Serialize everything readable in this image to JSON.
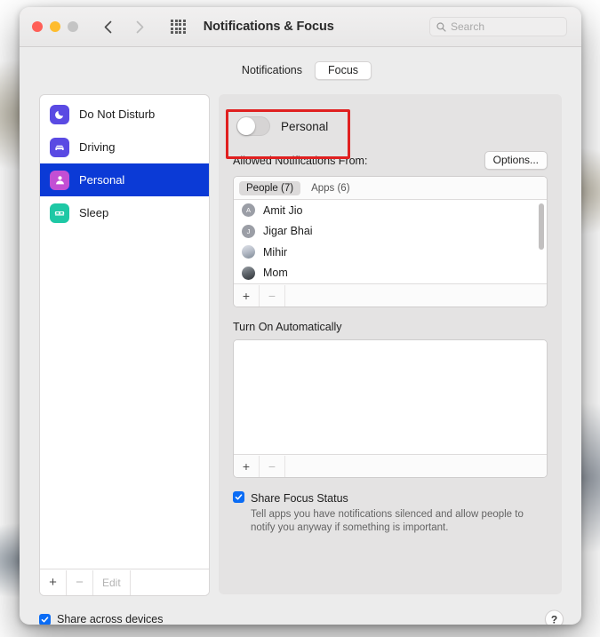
{
  "window": {
    "title": "Notifications & Focus",
    "traffic_lights": [
      "close",
      "minimize",
      "zoom"
    ],
    "back_label": "‹",
    "forward_label": "›"
  },
  "search": {
    "placeholder": "Search",
    "value": ""
  },
  "segmented": {
    "tabs": [
      {
        "label": "Notifications",
        "active": false
      },
      {
        "label": "Focus",
        "active": true
      }
    ]
  },
  "sidebar": {
    "items": [
      {
        "label": "Do Not Disturb",
        "icon": "moon-icon",
        "color": "#5a4ae3",
        "selected": false
      },
      {
        "label": "Driving",
        "icon": "car-icon",
        "color": "#5a4ae3",
        "selected": false
      },
      {
        "label": "Personal",
        "icon": "person-icon",
        "color": "#c34fd4",
        "selected": true
      },
      {
        "label": "Sleep",
        "icon": "bed-icon",
        "color": "#1ec8a5",
        "selected": false
      }
    ],
    "footer": {
      "add_label": "+",
      "remove_label": "−",
      "edit_label": "Edit"
    }
  },
  "detail": {
    "toggle": {
      "name": "Personal",
      "on": false
    },
    "allowed": {
      "title": "Allowed Notifications From:",
      "options_button": "Options...",
      "tabs": [
        {
          "label": "People (7)",
          "active": true
        },
        {
          "label": "Apps (6)",
          "active": false
        }
      ],
      "people": [
        {
          "name": "Amit Jio",
          "initial": "A",
          "avatar": "initial"
        },
        {
          "name": "Jigar Bhai",
          "initial": "J",
          "avatar": "initial"
        },
        {
          "name": "Mihir",
          "initial": "",
          "avatar": "photo1"
        },
        {
          "name": "Mom",
          "initial": "",
          "avatar": "photo2"
        }
      ],
      "footer": {
        "add_label": "+",
        "remove_label": "−"
      }
    },
    "turn_on": {
      "title": "Turn On Automatically",
      "items": [],
      "footer": {
        "add_label": "+",
        "remove_label": "−"
      }
    },
    "share_focus": {
      "label": "Share Focus Status",
      "checked": true,
      "description": "Tell apps you have notifications silenced and allow people to notify you anyway if something is important."
    }
  },
  "bottom": {
    "share_across_devices": {
      "label": "Share across devices",
      "checked": true
    },
    "help_label": "?"
  },
  "annotation": {
    "type": "red-rectangle",
    "color": "#e02020",
    "target": "focus-toggle"
  }
}
